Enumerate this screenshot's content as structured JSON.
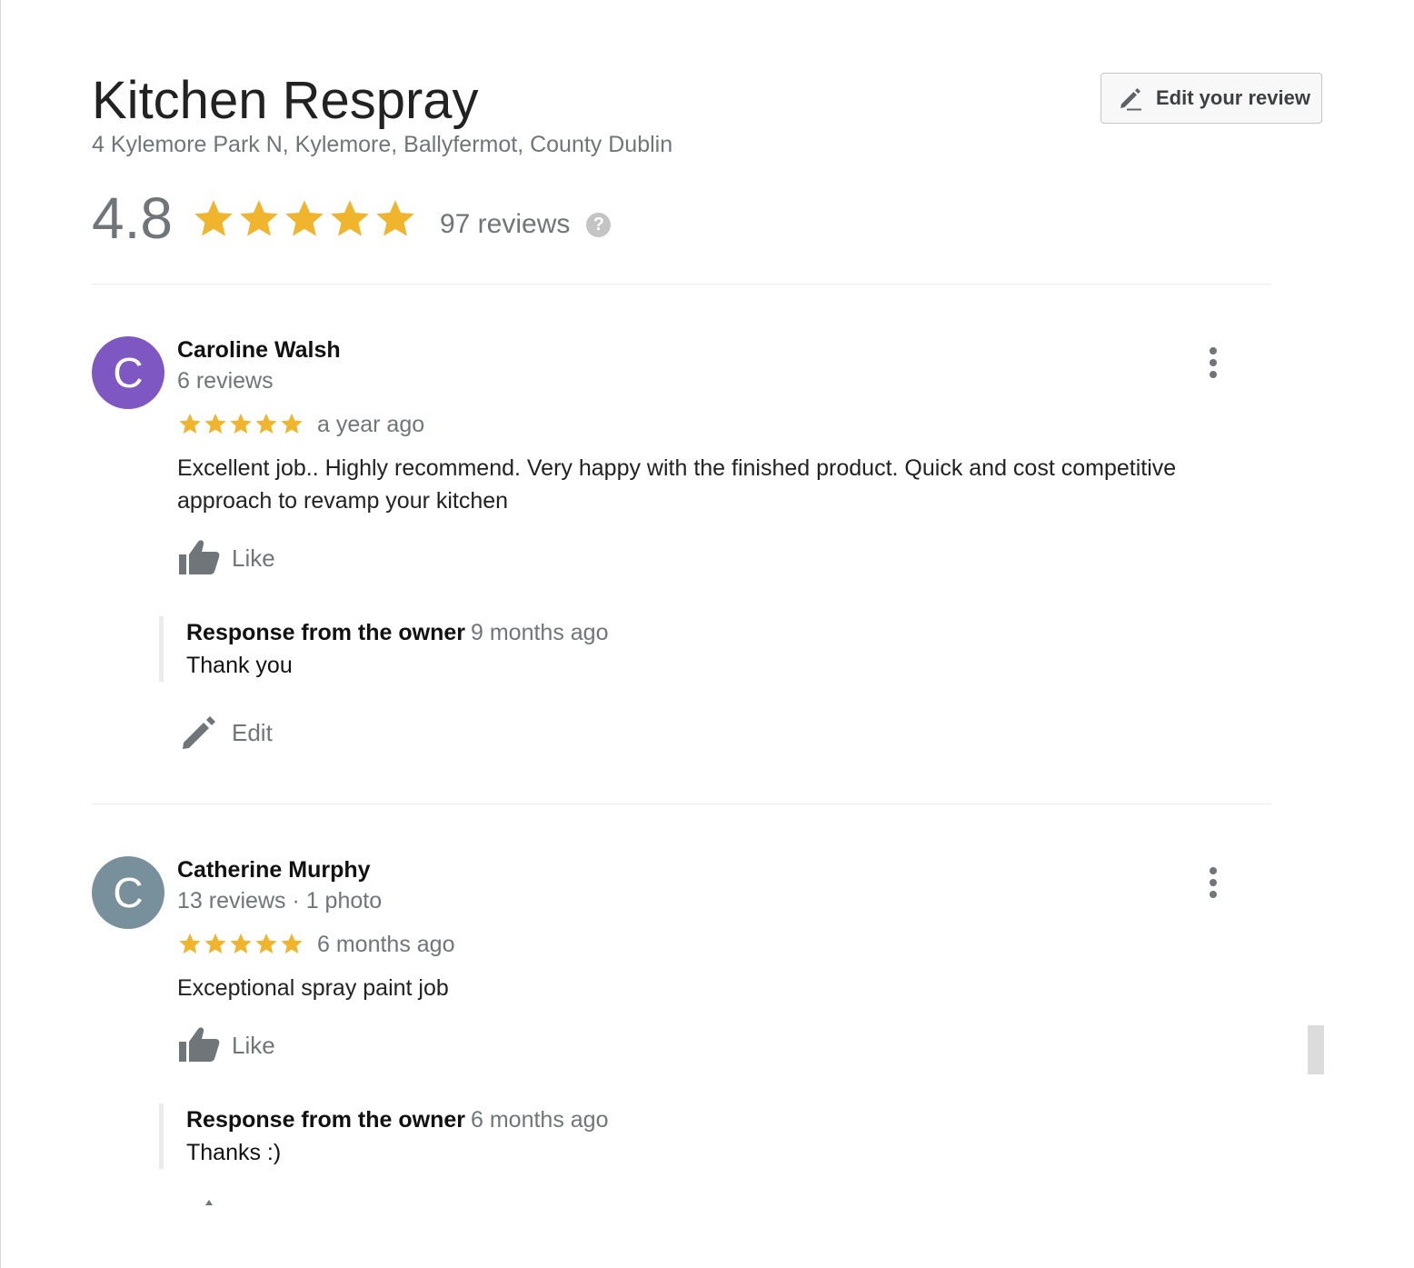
{
  "business": {
    "name": "Kitchen Respray",
    "address": "4 Kylemore Park N, Kylemore, Ballyfermot, County Dublin"
  },
  "edit_review_button": {
    "label": "Edit your review",
    "icon": "pencil-icon"
  },
  "summary": {
    "rating": "4.8",
    "stars": 5,
    "review_count": "97 reviews",
    "help_icon_glyph": "?"
  },
  "colors": {
    "star": "#f1b52d",
    "avatar_purple": "#7e57c2",
    "avatar_grey": "#78909c",
    "secondary_text": "#70757a"
  },
  "reviews": [
    {
      "avatar_letter": "C",
      "avatar_color": "#7e57c2",
      "name": "Caroline Walsh",
      "meta": "6 reviews",
      "stars": 5,
      "date": "a year ago",
      "text": "Excellent job.. Highly recommend. Very happy with the finished product. Quick and cost competitive approach to revamp your kitchen",
      "like_label": "Like",
      "owner_response": {
        "label": "Response from the owner",
        "date": "9 months ago",
        "text": "Thank you"
      },
      "edit_label": "Edit"
    },
    {
      "avatar_letter": "C",
      "avatar_color": "#78909c",
      "name": "Catherine Murphy",
      "meta": "13 reviews · 1 photo",
      "stars": 5,
      "date": "6 months ago",
      "text": "Exceptional spray paint job",
      "like_label": "Like",
      "owner_response": {
        "label": "Response from the owner",
        "date": "6 months ago",
        "text": "Thanks :)"
      }
    }
  ]
}
